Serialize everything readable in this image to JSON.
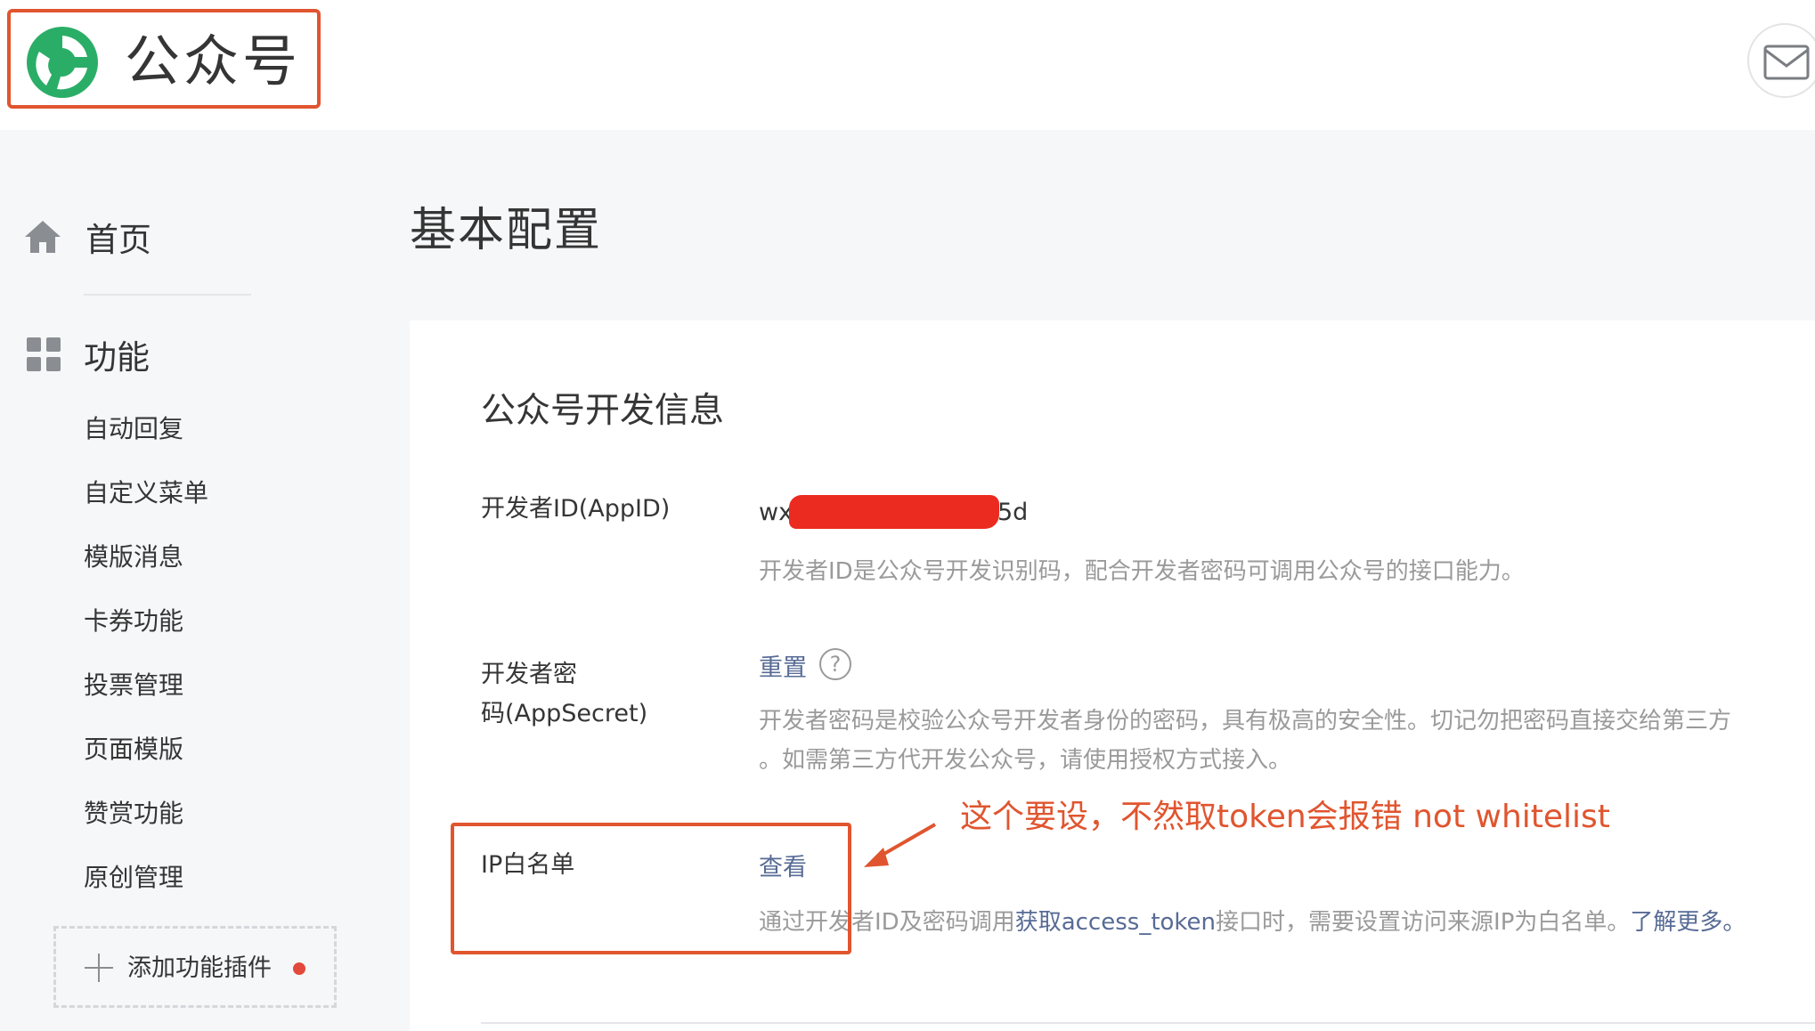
{
  "header": {
    "logo_text": "公众号",
    "icon": "mail-icon"
  },
  "sidebar": {
    "home_label": "首页",
    "function_label": "功能",
    "items": [
      {
        "label": "自动回复"
      },
      {
        "label": "自定义菜单"
      },
      {
        "label": "模版消息"
      },
      {
        "label": "卡券功能"
      },
      {
        "label": "投票管理"
      },
      {
        "label": "页面模版"
      },
      {
        "label": "赞赏功能"
      },
      {
        "label": "原创管理"
      }
    ],
    "add_plugin_label": "添加功能插件"
  },
  "main": {
    "page_title": "基本配置",
    "section_title": "公众号开发信息",
    "appid": {
      "label": "开发者ID(AppID)",
      "value_prefix": "wx",
      "value_suffix": "5d",
      "desc": "开发者ID是公众号开发识别码，配合开发者密码可调用公众号的接口能力。"
    },
    "appsecret": {
      "label_line1": "开发者密",
      "label_line2": "码(AppSecret)",
      "reset_link": "重置",
      "help_glyph": "?",
      "desc_line1": "开发者密码是校验公众号开发者身份的密码，具有极高的安全性。切记勿把密码直接交给第三方",
      "desc_line2": "。如需第三方代开发公众号，请使用授权方式接入。"
    },
    "ip_whitelist": {
      "label": "IP白名单",
      "view_link": "查看",
      "desc_part1": "通过开发者ID及密码调用",
      "desc_link": "获取access_token",
      "desc_part2": "接口时，需要设置访问来源IP为白名单。",
      "learn_more": "了解更多。"
    }
  },
  "annotation": {
    "text": "这个要设，不然取token会报错 not whitelist",
    "color": "#e0552f"
  },
  "colors": {
    "accent_red": "#e0552f",
    "link": "#576b95",
    "redaction": "#ec2b20",
    "logo_green": "#2aae67"
  }
}
